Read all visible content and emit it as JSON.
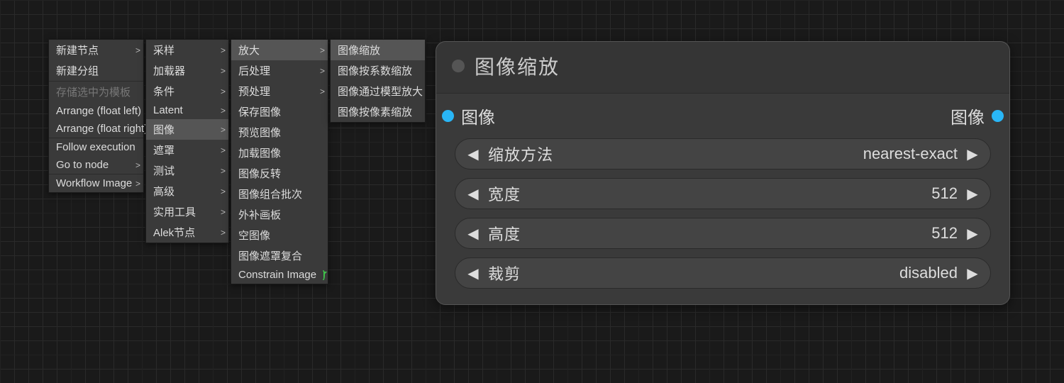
{
  "menus": {
    "level1": [
      {
        "label": "新建节点",
        "sub": true
      },
      {
        "label": "新建分组"
      },
      {
        "sep": true
      },
      {
        "label": "存储选中为模板",
        "disabled": true
      },
      {
        "label": "Arrange (float left)"
      },
      {
        "label": "Arrange (float right)"
      },
      {
        "sep": true
      },
      {
        "label": "Follow execution"
      },
      {
        "label": "Go to node",
        "sub": true
      },
      {
        "sep": true
      },
      {
        "label": "Workflow Image",
        "sub": true
      }
    ],
    "level2": [
      {
        "label": "采样",
        "sub": true
      },
      {
        "label": "加载器",
        "sub": true
      },
      {
        "label": "条件",
        "sub": true
      },
      {
        "label": "Latent",
        "sub": true
      },
      {
        "label": "图像",
        "sub": true,
        "hl": true
      },
      {
        "label": "遮罩",
        "sub": true
      },
      {
        "label": "测试",
        "sub": true
      },
      {
        "label": "高级",
        "sub": true
      },
      {
        "label": "实用工具",
        "sub": true
      },
      {
        "label": "Alek节点",
        "sub": true
      }
    ],
    "level3": [
      {
        "label": "放大",
        "sub": true,
        "hl": true
      },
      {
        "label": "后处理",
        "sub": true
      },
      {
        "label": "预处理",
        "sub": true
      },
      {
        "label": "保存图像"
      },
      {
        "label": "预览图像"
      },
      {
        "label": "加载图像"
      },
      {
        "label": "图像反转"
      },
      {
        "label": "图像组合批次"
      },
      {
        "label": "外补画板"
      },
      {
        "label": "空图像"
      },
      {
        "label": "图像遮罩复合"
      },
      {
        "label": "Constrain Image",
        "refresh": true
      }
    ],
    "level4": [
      {
        "label": "图像缩放",
        "hl": true
      },
      {
        "label": "图像按系数缩放"
      },
      {
        "label": "图像通过模型放大"
      },
      {
        "label": "图像按像素缩放"
      }
    ]
  },
  "node": {
    "title": "图像缩放",
    "input_label": "图像",
    "output_label": "图像",
    "params": [
      {
        "label": "缩放方法",
        "value": "nearest-exact"
      },
      {
        "label": "宽度",
        "value": "512"
      },
      {
        "label": "高度",
        "value": "512"
      },
      {
        "label": "裁剪",
        "value": "disabled"
      }
    ]
  }
}
